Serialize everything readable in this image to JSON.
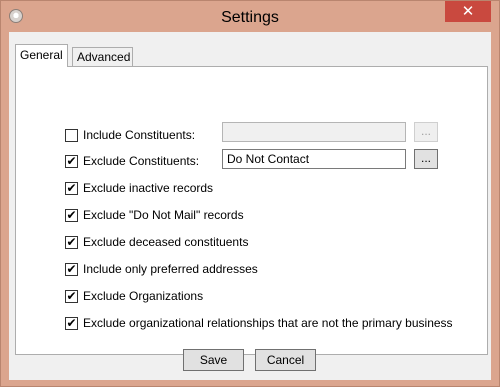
{
  "window": {
    "title": "Settings",
    "close_glyph": "✕"
  },
  "tabs": [
    {
      "label": "General",
      "selected": true
    },
    {
      "label": "Advanced",
      "selected": false
    }
  ],
  "general": {
    "include_constituents": {
      "label": "Include Constituents:",
      "checked": false,
      "value": "",
      "browse_label": "...",
      "enabled": false
    },
    "exclude_constituents": {
      "label": "Exclude Constituents:",
      "checked": true,
      "value": "Do Not Contact",
      "browse_label": "...",
      "enabled": true
    },
    "options": [
      {
        "label": "Exclude inactive records",
        "checked": true
      },
      {
        "label": "Exclude \"Do Not Mail\" records",
        "checked": true
      },
      {
        "label": "Exclude deceased constituents",
        "checked": true
      },
      {
        "label": "Include only preferred addresses",
        "checked": true
      },
      {
        "label": "Exclude Organizations",
        "checked": true
      },
      {
        "label": "Exclude organizational relationships that are not the primary business",
        "checked": true
      }
    ]
  },
  "buttons": {
    "save": "Save",
    "cancel": "Cancel"
  },
  "icons": {
    "app": "settings-app-icon",
    "check": "✔"
  },
  "colors": {
    "window_frame": "#dba58e",
    "close_button": "#c9493f"
  }
}
